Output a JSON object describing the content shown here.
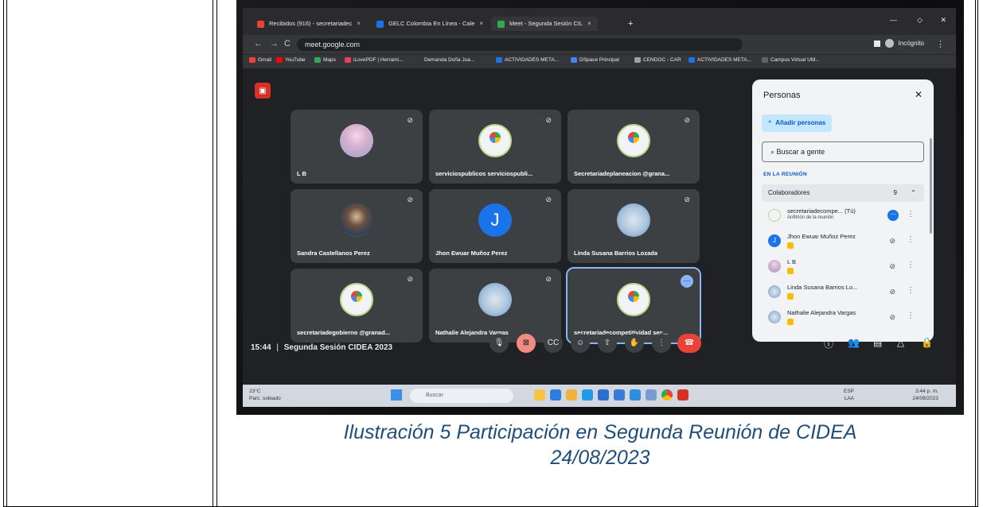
{
  "browser": {
    "tabs": [
      {
        "label": "Recibidos (916) - secretariadec",
        "close": "×"
      },
      {
        "label": "GELC Colombia En Línea - Cale",
        "close": "×"
      },
      {
        "label": "Meet - Segunda Sesión CIL",
        "close": "×"
      }
    ],
    "new_tab": "+",
    "url": "meet.google.com",
    "incognito_label": "Incógnito",
    "bookmarks": [
      "Gmail",
      "YouTube",
      "Maps",
      "iLovePDF | Herrami...",
      "Demanda Doña Jua...",
      "ACTIVIDADES META...",
      "DSpace Principal",
      "CENDOC - CAR",
      "ACTIVIDADES META...",
      "Campus Virtual UM..."
    ],
    "bookmark_colors": [
      "#ea4335",
      "#ff0000",
      "#34a853",
      "#e94057",
      "#c7c9cc",
      "#1a73e8",
      "#4285f4",
      "#9aa0a6",
      "#1a73e8",
      "#5f6368"
    ]
  },
  "meet": {
    "tiles": [
      {
        "name": "L B",
        "avatar": "flower"
      },
      {
        "name": "serviciospublicos serviciospubli...",
        "avatar": "logo"
      },
      {
        "name": "Secretariadeplaneacion @grana...",
        "avatar": "logo"
      },
      {
        "name": "Sandra Castellanos Perez",
        "avatar": "photo"
      },
      {
        "name": "Jhon Ewuar Muñoz Perez",
        "avatar": "J"
      },
      {
        "name": "Linda Susana Barrios Lozada",
        "avatar": "40"
      },
      {
        "name": "secretariadegobierno @granad...",
        "avatar": "logo"
      },
      {
        "name": "Nathalie Alejandra Vargas",
        "avatar": "40"
      },
      {
        "name": "secretariadecompetitividad sec...",
        "avatar": "logo"
      }
    ],
    "time": "15:44",
    "separator": "|",
    "meeting_title": "Segunda Sesión CIDEA 2023"
  },
  "people_panel": {
    "title": "Personas",
    "add_people": "Añadir personas",
    "search_placeholder": "Buscar a gente",
    "section": "EN LA REUNIÓN",
    "group_label": "Colaboradores",
    "group_count": "9",
    "participants": [
      {
        "name": "secretariadecompe... (Tú)",
        "subtitle": "Anfitrión de la reunión"
      },
      {
        "name": "Jhon Ewuar Muñoz Perez",
        "subtitle": ""
      },
      {
        "name": "L B",
        "subtitle": ""
      },
      {
        "name": "Linda Susana Barrios Lo...",
        "subtitle": ""
      },
      {
        "name": "Nathalie Alejandra Vargas",
        "subtitle": ""
      }
    ]
  },
  "taskbar": {
    "temperature": "23°C",
    "weather": "Parc. soleado",
    "search_placeholder": "Buscar",
    "lang_line1": "ESP",
    "lang_line2": "LAA",
    "clock_time": "3:44 p. m.",
    "clock_date": "24/08/2023"
  },
  "caption": {
    "line1": "Ilustración 5 Participación en Segunda Reunión de CIDEA",
    "line2": "24/08/2023"
  }
}
